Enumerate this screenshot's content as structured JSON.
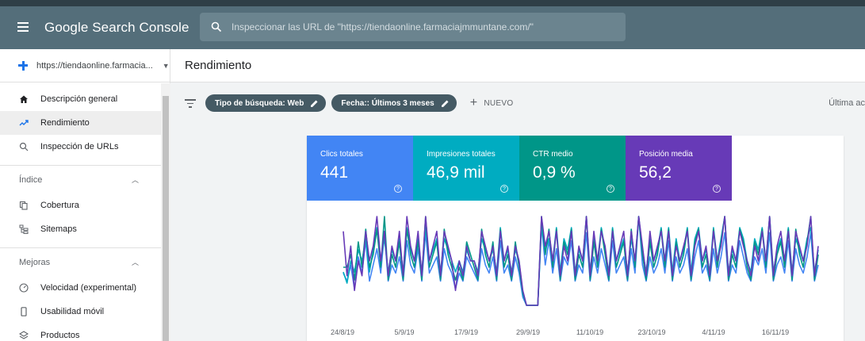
{
  "app": {
    "title": "Google Search Console",
    "search_placeholder": "Inspeccionar las URL de \"https://tiendaonline.farmaciajmmuntane.com/\""
  },
  "sidebar": {
    "property": "https://tiendaonline.farmacia...",
    "items_top": [
      {
        "label": "Descripción general",
        "icon": "home-icon"
      },
      {
        "label": "Rendimiento",
        "icon": "trending-up-icon",
        "active": true
      },
      {
        "label": "Inspección de URLs",
        "icon": "search-icon"
      }
    ],
    "section_index": {
      "label": "Índice"
    },
    "items_index": [
      {
        "label": "Cobertura",
        "icon": "coverage-icon"
      },
      {
        "label": "Sitemaps",
        "icon": "sitemap-icon"
      }
    ],
    "section_improvements": {
      "label": "Mejoras"
    },
    "items_improvements": [
      {
        "label": "Velocidad (experimental)",
        "icon": "speed-icon"
      },
      {
        "label": "Usabilidad móvil",
        "icon": "mobile-icon"
      },
      {
        "label": "Productos",
        "icon": "products-icon"
      }
    ]
  },
  "main": {
    "title": "Rendimiento",
    "filters": [
      {
        "label": "Tipo de búsqueda: Web"
      },
      {
        "label": "Fecha:: Últimos 3 meses"
      }
    ],
    "new_label": "NUEVO",
    "last_update": "Última ac"
  },
  "metrics": [
    {
      "label": "Clics totales",
      "value": "441",
      "color": "#4285f4"
    },
    {
      "label": "Impresiones totales",
      "value": "46,9 mil",
      "color": "#00acc1"
    },
    {
      "label": "CTR medio",
      "value": "0,9 %",
      "color": "#009688"
    },
    {
      "label": "Posición media",
      "value": "56,2",
      "color": "#673ab7"
    }
  ],
  "chart_data": {
    "type": "line",
    "x_ticks": [
      "24/8/19",
      "5/9/19",
      "17/9/19",
      "29/9/19",
      "11/10/19",
      "23/10/19",
      "4/11/19",
      "16/11/19"
    ],
    "series": [
      {
        "name": "Clics totales",
        "color": "#4285f4",
        "values": [
          4,
          3,
          5,
          2,
          6,
          4,
          8,
          3,
          5,
          7,
          4,
          9,
          3,
          5,
          4,
          6,
          3,
          8,
          5,
          4,
          7,
          3,
          9,
          4,
          5,
          6,
          3,
          7,
          5,
          4,
          2,
          4,
          3,
          6,
          5,
          4,
          3,
          7,
          5,
          4,
          6,
          3,
          8,
          4,
          5,
          3,
          6,
          4,
          1,
          0,
          0,
          0,
          0,
          10,
          5,
          8,
          4,
          7,
          3,
          6,
          5,
          8,
          3,
          5,
          4,
          9,
          3,
          6,
          4,
          7,
          5,
          3,
          8,
          4,
          5,
          6,
          3,
          7,
          4,
          11,
          5,
          3,
          6,
          4,
          5,
          7,
          4,
          8,
          3,
          6,
          4,
          5,
          7,
          3,
          6,
          8,
          4,
          5,
          3,
          7,
          4,
          6,
          9,
          3,
          5,
          4,
          8,
          6,
          4,
          3,
          6,
          5,
          7,
          4,
          9,
          3,
          5,
          6,
          4,
          8,
          3,
          7,
          5,
          4,
          6,
          9,
          3,
          5
        ]
      },
      {
        "name": "Impresiones totales",
        "color": "#00acc1",
        "values": [
          5,
          4,
          6,
          5,
          7,
          6,
          8,
          5,
          7,
          9,
          6,
          8,
          5,
          7,
          6,
          8,
          5,
          9,
          7,
          6,
          8,
          5,
          9,
          6,
          7,
          8,
          5,
          8,
          7,
          6,
          5,
          6,
          5,
          7,
          6,
          6,
          5,
          8,
          7,
          6,
          7,
          5,
          9,
          6,
          7,
          5,
          7,
          6,
          3,
          2,
          2,
          2,
          2,
          9,
          7,
          8,
          6,
          9,
          5,
          8,
          7,
          9,
          5,
          7,
          6,
          10,
          5,
          8,
          6,
          9,
          7,
          5,
          9,
          6,
          7,
          8,
          5,
          8,
          6,
          10,
          7,
          5,
          8,
          6,
          7,
          9,
          6,
          9,
          5,
          8,
          6,
          7,
          9,
          5,
          8,
          9,
          6,
          7,
          5,
          9,
          6,
          8,
          10,
          5,
          7,
          6,
          9,
          8,
          6,
          5,
          8,
          7,
          9,
          6,
          10,
          5,
          7,
          8,
          6,
          9,
          5,
          8,
          7,
          6,
          8,
          9,
          5,
          7
        ]
      },
      {
        "name": "CTR medio",
        "color": "#009688",
        "values": [
          3,
          3,
          4,
          2,
          5,
          3,
          6,
          3,
          4,
          6,
          3,
          7,
          2,
          4,
          3,
          5,
          2,
          6,
          4,
          3,
          5,
          2,
          7,
          3,
          4,
          5,
          2,
          6,
          4,
          3,
          2,
          3,
          2,
          5,
          4,
          3,
          2,
          6,
          4,
          3,
          5,
          2,
          6,
          3,
          4,
          2,
          5,
          3,
          1,
          0,
          0,
          0,
          0,
          7,
          4,
          6,
          3,
          6,
          2,
          5,
          4,
          6,
          2,
          4,
          3,
          7,
          2,
          5,
          3,
          6,
          4,
          2,
          6,
          3,
          4,
          5,
          2,
          6,
          3,
          7,
          4,
          2,
          5,
          3,
          4,
          6,
          3,
          6,
          2,
          5,
          3,
          4,
          6,
          2,
          5,
          6,
          3,
          4,
          2,
          6,
          3,
          5,
          7,
          2,
          4,
          3,
          6,
          5,
          3,
          2,
          5,
          4,
          6,
          3,
          7,
          2,
          4,
          5,
          3,
          6,
          2,
          6,
          4,
          3,
          5,
          7,
          2,
          4
        ]
      },
      {
        "name": "Posición media",
        "color": "#673ab7",
        "values": [
          3.5,
          3.2,
          3.4,
          3.1,
          3.3,
          3.2,
          3.5,
          3.3,
          3.4,
          3.6,
          3.3,
          3.5,
          3.2,
          3.4,
          3.3,
          3.5,
          3.2,
          3.6,
          3.4,
          3.3,
          3.5,
          3.2,
          3.6,
          3.3,
          3.4,
          3.5,
          3.2,
          3.5,
          3.4,
          3.3,
          3.1,
          3.3,
          3.2,
          3.4,
          3.3,
          3.3,
          3.2,
          3.5,
          3.4,
          3.3,
          3.4,
          3.2,
          3.5,
          3.3,
          3.4,
          3.2,
          3.4,
          3.3,
          3.1,
          3.0,
          3.0,
          3.0,
          3.0,
          3.6,
          3.4,
          3.5,
          3.3,
          3.5,
          3.2,
          3.4,
          3.3,
          3.5,
          3.2,
          3.4,
          3.3,
          3.6,
          3.2,
          3.5,
          3.3,
          3.5,
          3.4,
          3.2,
          3.5,
          3.3,
          3.4,
          3.5,
          3.2,
          3.5,
          3.3,
          3.6,
          3.4,
          3.2,
          3.5,
          3.3,
          3.4,
          3.5,
          3.3,
          3.5,
          3.2,
          3.4,
          3.3,
          3.4,
          3.5,
          3.2,
          3.4,
          3.5,
          3.3,
          3.4,
          3.2,
          3.5,
          3.3,
          3.4,
          3.6,
          3.2,
          3.4,
          3.3,
          3.5,
          3.4,
          3.3,
          3.2,
          3.4,
          3.3,
          3.5,
          3.3,
          3.6,
          3.2,
          3.4,
          3.5,
          3.3,
          3.5,
          3.2,
          3.5,
          3.4,
          3.3,
          3.4,
          3.6,
          3.2,
          3.4
        ]
      }
    ]
  }
}
